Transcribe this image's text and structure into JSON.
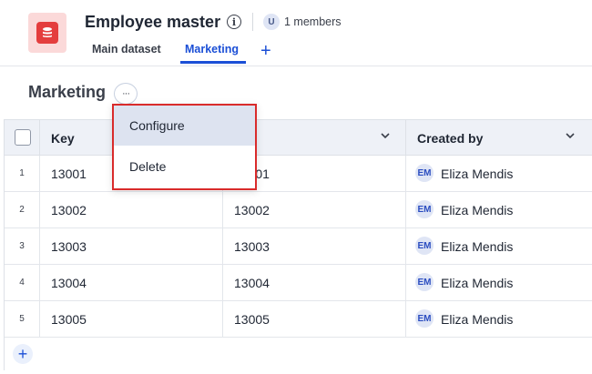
{
  "header": {
    "title": "Employee master",
    "member_avatar": "U",
    "members": "1 members",
    "app_icon": "database-icon",
    "tabs": [
      {
        "label": "Main dataset",
        "active": false
      },
      {
        "label": "Marketing",
        "active": true
      }
    ],
    "add_tab": "+"
  },
  "section": {
    "title": "Marketing",
    "more": "···"
  },
  "table": {
    "columns": [
      {
        "label": "Key"
      },
      {
        "label": ""
      },
      {
        "label": "Created by"
      }
    ],
    "rows": [
      {
        "num": "1",
        "key": "13001",
        "col2": "13001",
        "avatar": "EM",
        "created_by": "Eliza Mendis"
      },
      {
        "num": "2",
        "key": "13002",
        "col2": "13002",
        "avatar": "EM",
        "created_by": "Eliza Mendis"
      },
      {
        "num": "3",
        "key": "13003",
        "col2": "13003",
        "avatar": "EM",
        "created_by": "Eliza Mendis"
      },
      {
        "num": "4",
        "key": "13004",
        "col2": "13004",
        "avatar": "EM",
        "created_by": "Eliza Mendis"
      },
      {
        "num": "5",
        "key": "13005",
        "col2": "13005",
        "avatar": "EM",
        "created_by": "Eliza Mendis"
      }
    ],
    "add_row": "+"
  },
  "menu": {
    "items": [
      {
        "label": "Configure"
      },
      {
        "label": "Delete"
      }
    ]
  },
  "colors": {
    "accent": "#1b4fd6",
    "brand_red": "#e43d3d",
    "menu_border": "#d92b2b"
  }
}
